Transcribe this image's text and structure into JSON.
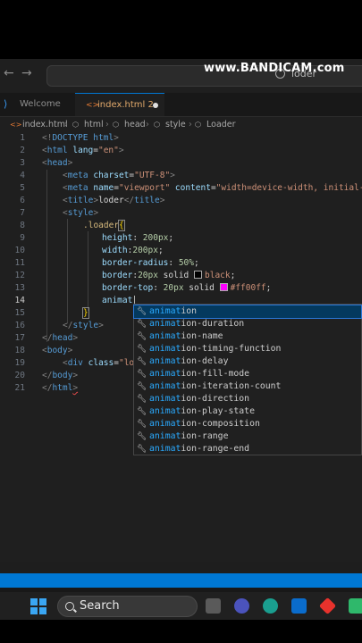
{
  "watermark": "www.BANDICAM.com",
  "title_bar": {
    "back": "←",
    "forward": "→",
    "search_text": "loder"
  },
  "tabs": [
    {
      "label": "Welcome"
    },
    {
      "label": "index.html 2"
    }
  ],
  "breadcrumb": [
    "index.html",
    "html",
    "head",
    "style",
    "Loader"
  ],
  "lines": [
    {
      "n": "1"
    },
    {
      "n": "2"
    },
    {
      "n": "3"
    },
    {
      "n": "4"
    },
    {
      "n": "5"
    },
    {
      "n": "6"
    },
    {
      "n": "7"
    },
    {
      "n": "8"
    },
    {
      "n": "9"
    },
    {
      "n": "10"
    },
    {
      "n": "11"
    },
    {
      "n": "12"
    },
    {
      "n": "13"
    },
    {
      "n": "14"
    },
    {
      "n": "15"
    },
    {
      "n": "16"
    },
    {
      "n": "17"
    },
    {
      "n": "18"
    },
    {
      "n": "19"
    },
    {
      "n": "20"
    },
    {
      "n": "21"
    }
  ],
  "code": {
    "l1": [
      "<!",
      "DOCTYPE",
      " html",
      ">"
    ],
    "l2": [
      "<",
      "html",
      " lang",
      "=",
      "\"en\"",
      ">"
    ],
    "l3": [
      "<",
      "head",
      ">"
    ],
    "l4": [
      "<",
      "meta",
      " charset",
      "=",
      "\"UTF-8\"",
      ">"
    ],
    "l5": [
      "<",
      "meta",
      " name",
      "=",
      "\"viewport\"",
      " content",
      "=",
      "\"width=device-width, initial-s"
    ],
    "l6": [
      "<",
      "title",
      ">",
      "loder",
      "</",
      "title",
      ">"
    ],
    "l7": [
      "<",
      "style",
      ">"
    ],
    "l8": [
      ".loader",
      "{"
    ],
    "l9": [
      "height",
      ": ",
      "200px",
      ";"
    ],
    "l10": [
      "width",
      ":",
      "200px",
      ";"
    ],
    "l11": [
      "border-radius",
      ": ",
      "50%",
      ";"
    ],
    "l12": [
      "border",
      ":",
      "20px",
      " solid ",
      "black",
      ";"
    ],
    "l13": [
      "border-top",
      ": ",
      "20px",
      " solid ",
      "#ff00ff",
      ";"
    ],
    "l14": [
      "animat"
    ],
    "l15": [
      "}"
    ],
    "l16": [
      "</",
      "style",
      ">"
    ],
    "l17": [
      "</",
      "head",
      ">"
    ],
    "l18": [
      "<",
      "body",
      ">"
    ],
    "l19": [
      "<",
      "div",
      " class",
      "=",
      "\"lo"
    ],
    "l20": [
      "</",
      "body",
      ">"
    ],
    "l21": [
      "</",
      "html",
      ">"
    ]
  },
  "colors": {
    "black_swatch": "#000000",
    "magenta_swatch": "#ff00ff",
    "accent": "#0078d4"
  },
  "suggestions": [
    {
      "match": "animat",
      "rest": "ion"
    },
    {
      "match": "animat",
      "rest": "ion-duration"
    },
    {
      "match": "animat",
      "rest": "ion-name"
    },
    {
      "match": "animat",
      "rest": "ion-timing-function"
    },
    {
      "match": "animat",
      "rest": "ion-delay"
    },
    {
      "match": "animat",
      "rest": "ion-fill-mode"
    },
    {
      "match": "animat",
      "rest": "ion-iteration-count"
    },
    {
      "match": "animat",
      "rest": "ion-direction"
    },
    {
      "match": "animat",
      "rest": "ion-play-state"
    },
    {
      "match": "animat",
      "rest": "ion-composition"
    },
    {
      "match": "animat",
      "rest": "ion-range"
    },
    {
      "match": "animat",
      "rest": "ion-range-end"
    }
  ],
  "taskbar": {
    "search_label": "Search"
  }
}
